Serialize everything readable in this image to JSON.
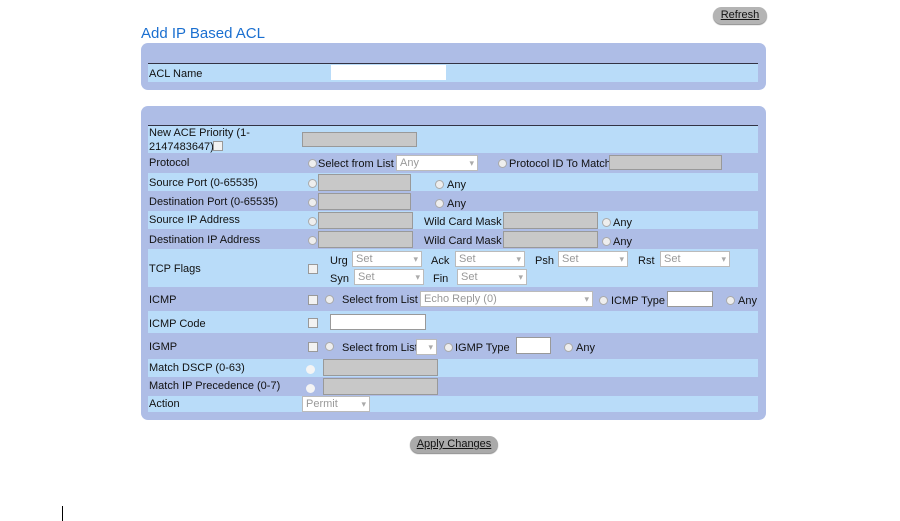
{
  "page": {
    "title": "Add IP Based ACL",
    "refresh": "Refresh",
    "apply": "Apply Changes"
  },
  "acl": {
    "name_label": "ACL Name",
    "name_value": ""
  },
  "ace": {
    "priority_label_1": "New ACE Priority (1-",
    "priority_label_2": "2147483647)",
    "protocol_label": "Protocol",
    "select_from_list": "Select from List",
    "protocol_value": "Any",
    "protocol_id": "Protocol ID To Match",
    "source_port": "Source Port (0-65535)",
    "dest_port": "Destination Port (0-65535)",
    "any": "Any",
    "source_ip": "Source IP Address",
    "dest_ip": "Destination IP Address",
    "wildcard": "Wild Card Mask",
    "tcp_flags": "TCP Flags",
    "flags": [
      {
        "name": "Urg",
        "value": "Set"
      },
      {
        "name": "Ack",
        "value": "Set"
      },
      {
        "name": "Psh",
        "value": "Set"
      },
      {
        "name": "Rst",
        "value": "Set"
      },
      {
        "name": "Syn",
        "value": "Set"
      },
      {
        "name": "Fin",
        "value": "Set"
      }
    ],
    "icmp": "ICMP",
    "icmp_value": "Echo Reply (0)",
    "icmp_type": "ICMP Type",
    "icmp_code": "ICMP Code",
    "igmp": "IGMP",
    "igmp_type": "IGMP Type",
    "dscp": "Match DSCP (0-63)",
    "precedence": "Match IP Precedence (0-7)",
    "action": "Action",
    "action_value": "Permit"
  }
}
